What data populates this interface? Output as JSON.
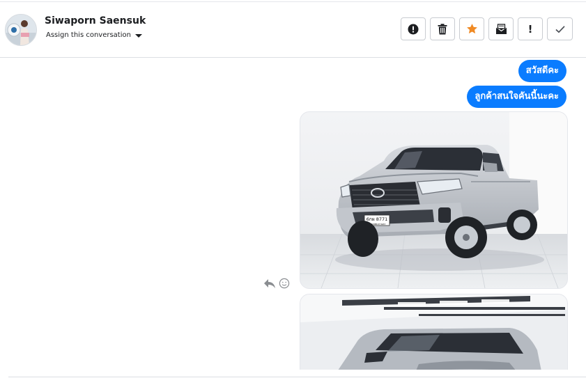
{
  "contact": {
    "name": "Siwaporn Saensuk",
    "assign_label": "Assign this conversation"
  },
  "toolbar": {
    "buttons": [
      {
        "name": "report-spam",
        "icon": "alert-circle-icon"
      },
      {
        "name": "delete",
        "icon": "trash-icon"
      },
      {
        "name": "star",
        "icon": "star-icon",
        "color": "#f08a24"
      },
      {
        "name": "mark-unread",
        "icon": "envelope-icon"
      },
      {
        "name": "mark-important",
        "icon": "exclamation-icon",
        "label": "!"
      },
      {
        "name": "mark-done",
        "icon": "check-icon"
      }
    ]
  },
  "messages": [
    {
      "type": "text",
      "text": "สวัสดีคะ"
    },
    {
      "type": "text",
      "text": "ลูกค้าสนใจคันนี้นะคะ"
    },
    {
      "type": "image",
      "description_icon": "silver-pickup-truck-photo"
    },
    {
      "type": "image",
      "description_icon": "silver-pickup-truck-photo"
    }
  ],
  "colors": {
    "bubble": "#0a7cff",
    "star": "#f08a24",
    "border": "#c9ccd1"
  },
  "plate": {
    "top": "6กผ 8771",
    "bottom": "กรุงเทพมหานคร"
  }
}
